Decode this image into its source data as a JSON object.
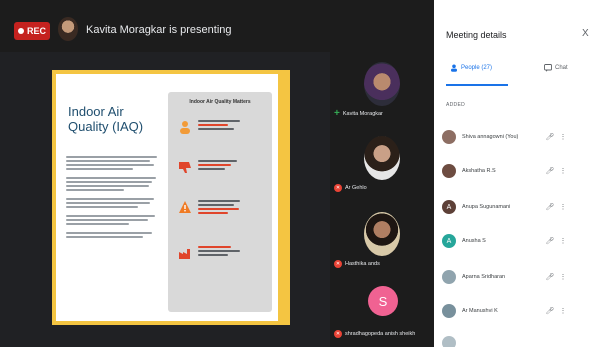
{
  "header": {
    "rec_label": "REC",
    "presenting_text": "Kavita Moragkar is presenting"
  },
  "slide": {
    "title": "Indoor Air Quality (IAQ)",
    "panel_title": "Indoor Air Quality Matters"
  },
  "tiles": [
    {
      "name": "Kavita Moragkar",
      "status": "pin"
    },
    {
      "name": "Ar Gehlo",
      "status": "muted"
    },
    {
      "name": "Hasthika ands",
      "status": "muted"
    },
    {
      "name": "shradhagopeda anish sheikh",
      "status": "muted",
      "initial": "S",
      "color": "#f06292"
    }
  ],
  "side_panel": {
    "title": "Meeting details",
    "close_glyph": "X",
    "tabs": [
      {
        "label": "People (27)",
        "active": true
      },
      {
        "label": "Chat",
        "active": false
      }
    ],
    "section_label": "ADDED",
    "participants": [
      {
        "name": "Shiva annagowni (You)",
        "initial": "",
        "color": "#8d6e63"
      },
      {
        "name": "Akshatha R.S",
        "initial": "",
        "color": "#6d4c41"
      },
      {
        "name": "Anupa Sugunamani",
        "initial": "A",
        "color": "#5d4037"
      },
      {
        "name": "Anusha S",
        "initial": "A",
        "color": "#26a69a"
      },
      {
        "name": "Aparna Sridharan",
        "initial": "",
        "color": "#90a4ae"
      },
      {
        "name": "Ar Manushvi K",
        "initial": "",
        "color": "#78909c"
      },
      {
        "name": "",
        "initial": "",
        "color": "#b0bec5"
      }
    ]
  }
}
